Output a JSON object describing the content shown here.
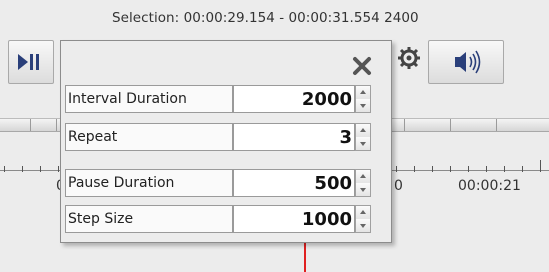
{
  "header": {
    "selection_text": "Selection: 00:00:29.154 - 00:00:31.554  2400"
  },
  "toolbar": {
    "play_pause_icon": "play-pause-icon",
    "settings_icon": "gear-icon",
    "volume_icon": "speaker-icon"
  },
  "timeline": {
    "tick_label_left": "0",
    "tick_label_mid": "0",
    "tick_label_right": "00:00:21"
  },
  "dialog": {
    "close_icon": "close-x-icon",
    "rows": [
      {
        "label": "Interval Duration",
        "value": "2000"
      },
      {
        "label": "Repeat",
        "value": "3"
      },
      {
        "label": "Pause Duration",
        "value": "500"
      },
      {
        "label": "Step Size",
        "value": "1000"
      }
    ]
  },
  "colors": {
    "playhead": "#e02020",
    "background": "#ececec",
    "close_x": "#555555"
  }
}
